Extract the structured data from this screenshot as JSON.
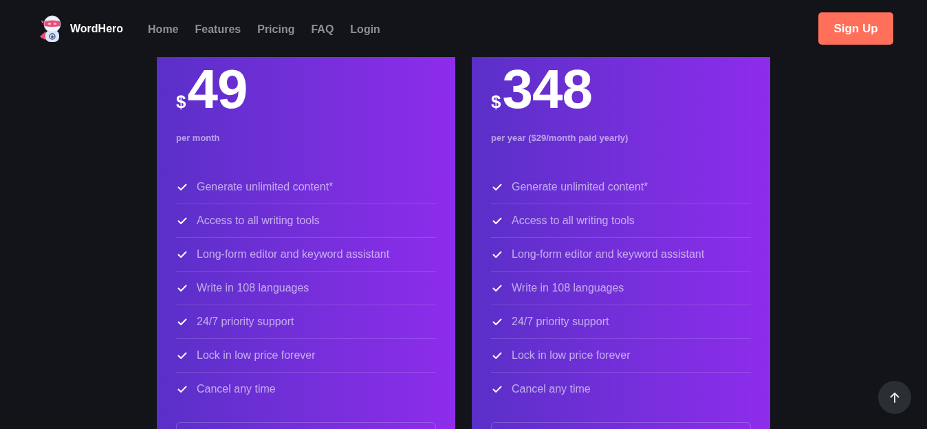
{
  "header": {
    "logo_text": "WordHero",
    "nav": [
      "Home",
      "Features",
      "Pricing",
      "FAQ",
      "Login"
    ],
    "signup_button": "Sign Up"
  },
  "plans": [
    {
      "currency": "$",
      "amount": "49",
      "period": "per month",
      "features": [
        "Generate unlimited content*",
        "Access to all writing tools",
        "Long-form editor and keyword assistant",
        "Write in 108 languages",
        "24/7 priority support",
        "Lock in low price forever",
        "Cancel any time"
      ]
    },
    {
      "currency": "$",
      "amount": "348",
      "period": "per year ($29/month paid yearly)",
      "features": [
        "Generate unlimited content*",
        "Access to all writing tools",
        "Long-form editor and keyword assistant",
        "Write in 108 languages",
        "24/7 priority support",
        "Lock in low price forever",
        "Cancel any time"
      ]
    }
  ]
}
